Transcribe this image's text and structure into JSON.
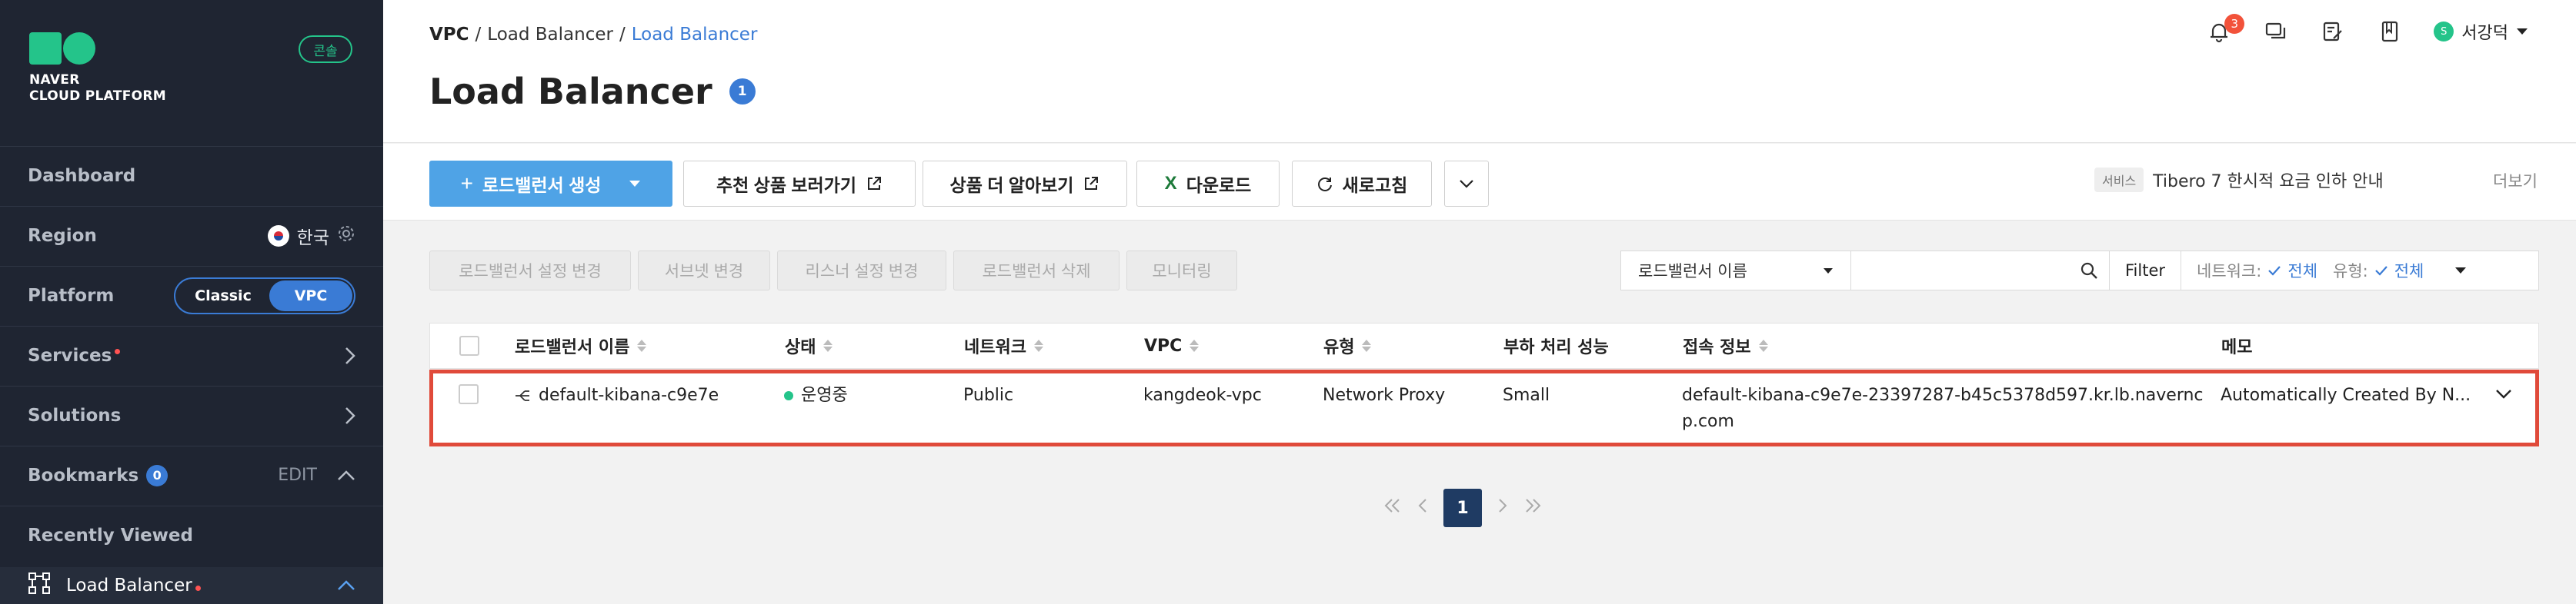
{
  "brand": {
    "line1": "NAVER",
    "line2": "CLOUD PLATFORM",
    "console_label": "콘솔"
  },
  "sidebar": {
    "dashboard": "Dashboard",
    "region": {
      "label": "Region",
      "value": "한국"
    },
    "platform": {
      "label": "Platform",
      "options": [
        "Classic",
        "VPC"
      ],
      "selected": "VPC"
    },
    "services": "Services",
    "solutions": "Solutions",
    "bookmarks": {
      "label": "Bookmarks",
      "count": "0",
      "edit": "EDIT"
    },
    "recently_viewed": "Recently Viewed",
    "current": "Load Balancer"
  },
  "breadcrumb": {
    "items": [
      "VPC",
      "Load Balancer",
      "Load Balancer"
    ]
  },
  "page": {
    "title": "Load Balancer",
    "count": "1"
  },
  "header": {
    "notification_count": "3",
    "user_name": "서강덕",
    "user_initial": "S"
  },
  "actions": {
    "create": "로드밸런서 생성",
    "recommend": "추천 상품 보러가기",
    "learn_more": "상품 더 알아보기",
    "download": "다운로드",
    "refresh": "새로고침"
  },
  "notice": {
    "tag": "서비스",
    "text": "Tibero 7 한시적 요금 인하 안내",
    "more": "더보기"
  },
  "toolbar": {
    "change_settings": "로드밸런서 설정 변경",
    "change_subnet": "서브넷 변경",
    "change_listener": "리스너 설정 변경",
    "delete": "로드밸런서 삭제",
    "monitoring": "모니터링"
  },
  "filter": {
    "select_value": "로드밸런서 이름",
    "search_value": "",
    "filter_label": "Filter",
    "network_label": "네트워크:",
    "network_value": "전체",
    "type_label": "유형:",
    "type_value": "전체"
  },
  "table": {
    "columns": [
      "로드밸런서 이름",
      "상태",
      "네트워크",
      "VPC",
      "유형",
      "부하 처리 성능",
      "접속 정보",
      "메모"
    ],
    "rows": [
      {
        "name": "default-kibana-c9e7e",
        "status": "운영중",
        "network": "Public",
        "vpc": "kangdeok-vpc",
        "type": "Network Proxy",
        "performance": "Small",
        "endpoint_line1": "default-kibana-c9e7e-23397287-b45c5378d597.kr.lb.navernc",
        "endpoint_line2": "p.com",
        "memo": "Automatically Created By N..."
      }
    ]
  },
  "pagination": {
    "current": "1"
  },
  "colors": {
    "accent": "#3a7bd5",
    "brand": "#24c48a",
    "sidebar_bg": "#1f2532",
    "highlight": "#e04a3a"
  }
}
